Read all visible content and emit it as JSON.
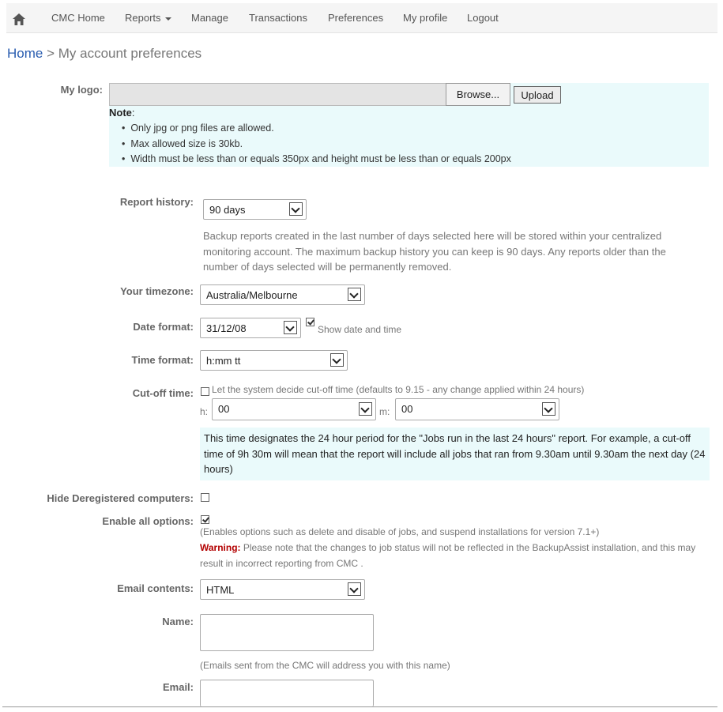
{
  "nav": {
    "items": [
      {
        "label": "CMC Home"
      },
      {
        "label": "Reports"
      },
      {
        "label": "Manage"
      },
      {
        "label": "Transactions"
      },
      {
        "label": "Preferences"
      },
      {
        "label": "My profile"
      },
      {
        "label": "Logout"
      }
    ]
  },
  "breadcrumb": {
    "home": "Home",
    "separator": " > ",
    "current": "My account preferences"
  },
  "logo": {
    "label": "My logo:",
    "browse_label": "Browse...",
    "upload_label": "Upload",
    "note_title": "Note",
    "note_colon": ":",
    "notes": [
      "Only jpg or png files are allowed.",
      "Max allowed size is 30kb.",
      "Width must be less than or equals 350px and height must be less than or equals 200px"
    ]
  },
  "report_history": {
    "label": "Report history:",
    "value": "90 days",
    "help": "Backup reports created in the last number of days selected here will be stored within your centralized monitoring account. The maximum backup history you can keep is 90 days. Any reports older than the number of days selected will be permanently removed."
  },
  "timezone": {
    "label": "Your timezone:",
    "value": "Australia/Melbourne"
  },
  "date_format": {
    "label": "Date format:",
    "value": "31/12/08",
    "show_date_time_label": "Show date and time",
    "show_date_time_checked": true
  },
  "time_format": {
    "label": "Time format:",
    "value": "h:mm tt"
  },
  "cutoff": {
    "label": "Cut-off time:",
    "auto_label": "Let the system decide cut-off time (defaults to 9.15 - any change applied within 24 hours)",
    "auto_checked": false,
    "hour_label": "h:",
    "hour_value": "00",
    "minute_label": "m:",
    "minute_value": "00",
    "info": "This time designates the 24 hour period for the \"Jobs run in the last 24 hours\" report. For example, a cut-off time of 9h 30m will mean that the report will include all jobs that ran from 9.30am until 9.30am the next day (24 hours)"
  },
  "hide_deregistered": {
    "label": "Hide Deregistered computers:",
    "checked": false
  },
  "enable_all": {
    "label": "Enable all options:",
    "checked": true,
    "help": "(Enables options such as delete and disable of jobs, and suspend installations for version 7.1+)",
    "warning_label": "Warning:",
    "warning_text": " Please note that the changes to job status will not be reflected in the BackupAssist installation, and this may result in incorrect reporting from CMC ."
  },
  "email_contents": {
    "label": "Email contents:",
    "value": "HTML"
  },
  "name": {
    "label": "Name:",
    "value": "",
    "help": "(Emails sent from the CMC will address you with this name)"
  },
  "email": {
    "label": "Email:",
    "value": ""
  },
  "colors": {
    "nav_bg": "#f5f5f5",
    "link": "#2a5db0",
    "info_bg": "#eafafb",
    "warning": "#b30000"
  }
}
